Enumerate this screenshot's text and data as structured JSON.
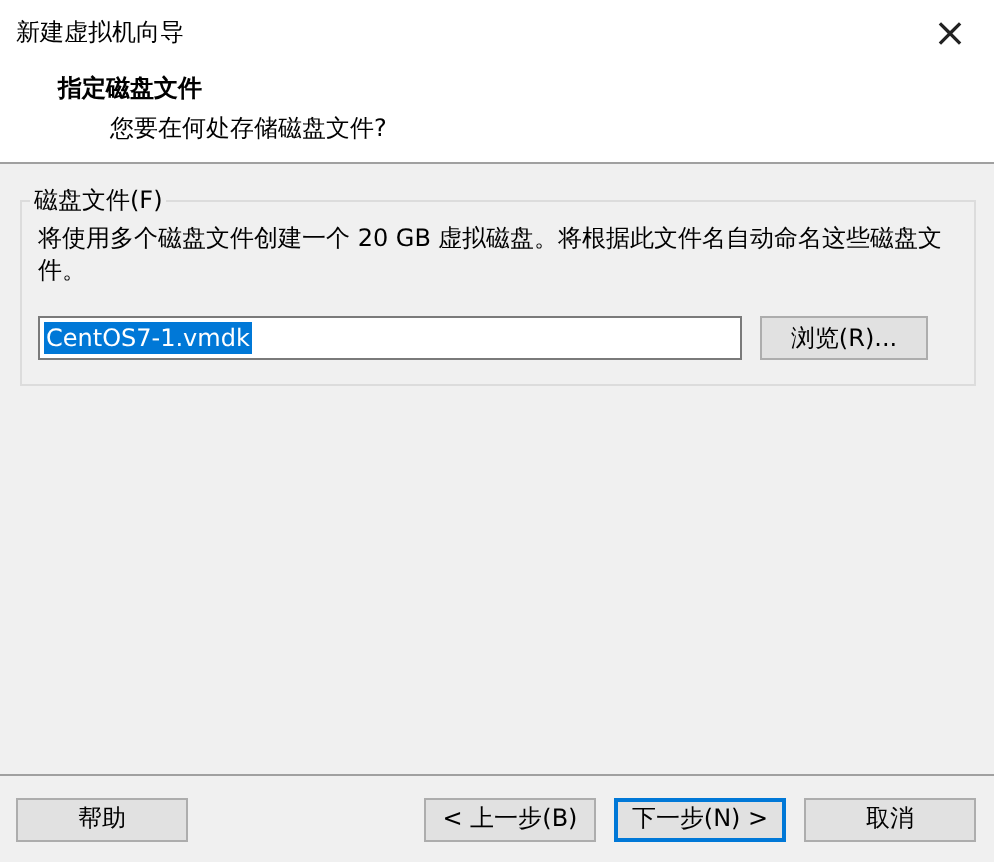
{
  "window": {
    "title": "新建虚拟机向导",
    "close": "×"
  },
  "header": {
    "title": "指定磁盘文件",
    "subtitle": "您要在何处存储磁盘文件?"
  },
  "group": {
    "label": "磁盘文件(F)",
    "description": "将使用多个磁盘文件创建一个 20 GB 虚拟磁盘。将根据此文件名自动命名这些磁盘文件。",
    "field": {
      "value": "CentOS7-1.vmdk",
      "selected": true
    },
    "browse": "浏览(R)..."
  },
  "buttons": [
    {
      "label": "帮助",
      "kind": "help",
      "focused": false
    },
    {
      "label": "< 上一步(B)",
      "kind": "nav",
      "focused": false
    },
    {
      "label": "下一步(N) >",
      "kind": "nav",
      "focused": true
    },
    {
      "label": "取消",
      "kind": "nav",
      "focused": false
    }
  ]
}
